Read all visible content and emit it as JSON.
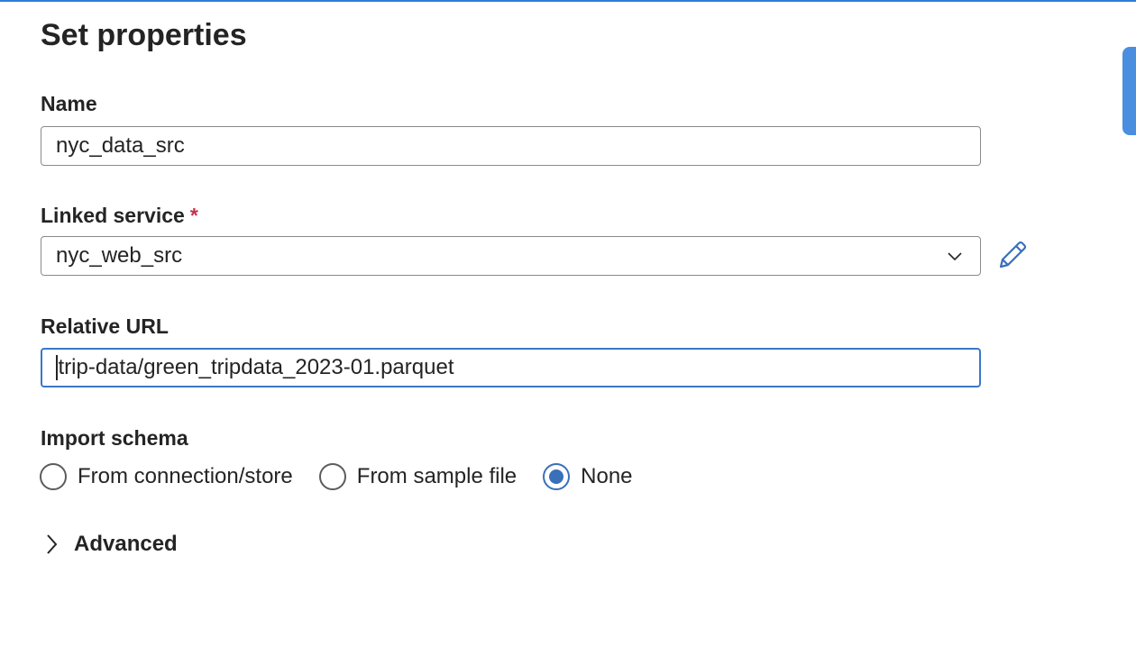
{
  "panel": {
    "title": "Set properties"
  },
  "name_field": {
    "label": "Name",
    "value": "nyc_data_src"
  },
  "linked_service": {
    "label": "Linked service",
    "required_mark": "*",
    "value": "nyc_web_src"
  },
  "relative_url": {
    "label": "Relative URL",
    "value": "trip-data/green_tripdata_2023-01.parquet"
  },
  "import_schema": {
    "label": "Import schema",
    "options": [
      {
        "label": "From connection/store",
        "checked": false
      },
      {
        "label": "From sample file",
        "checked": false
      },
      {
        "label": "None",
        "checked": true
      }
    ]
  },
  "advanced": {
    "label": "Advanced"
  },
  "icons": {
    "edit": "pencil-icon",
    "dropdown": "chevron-down-icon",
    "expand": "chevron-right-icon"
  },
  "colors": {
    "accent": "#3a6fba",
    "required": "#c4314b",
    "focus_border": "#3a78c9"
  }
}
